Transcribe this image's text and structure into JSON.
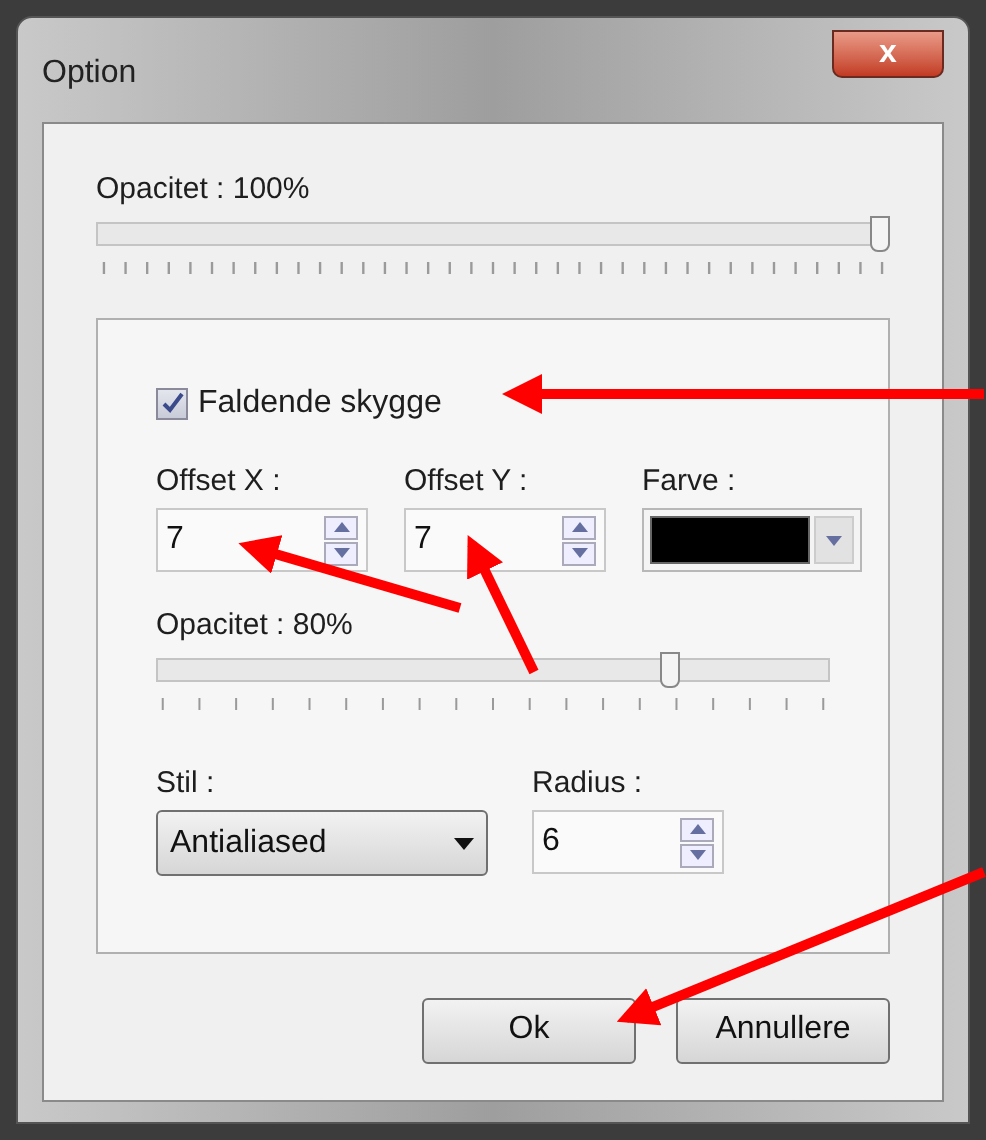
{
  "window": {
    "title": "Option",
    "close_label": "x"
  },
  "opacity": {
    "label": "Opacitet : 100%",
    "level": 1
  },
  "shadow_group": {
    "drop_shadow": {
      "label": "Faldende skygge",
      "checked": true
    },
    "offset_x": {
      "label": "Offset X :",
      "value": "7"
    },
    "offset_y": {
      "label": "Offset Y :",
      "value": "7"
    },
    "color_field": {
      "label": "Farve :",
      "color": "#000000"
    },
    "opacity": {
      "label": "Opacitet : 80%",
      "level": 0.77
    },
    "style": {
      "label": "Stil :",
      "value": "Antialiased"
    },
    "radius": {
      "label": "Radius :",
      "value": "6"
    }
  },
  "buttons": [
    "Ok",
    "Annullere"
  ]
}
